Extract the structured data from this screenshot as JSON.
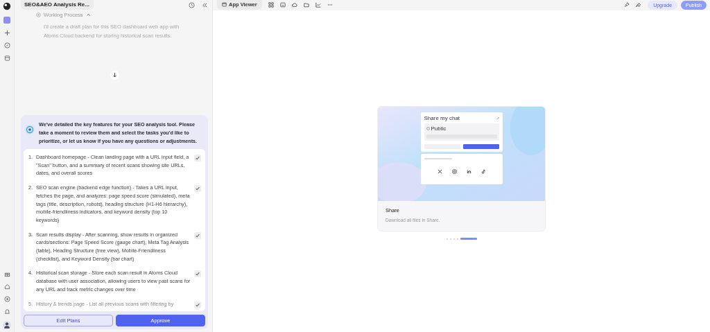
{
  "sidebar": {
    "items": [
      {
        "kind": "avatar",
        "selected": true
      },
      {
        "kind": "plus",
        "selected": false
      },
      {
        "kind": "compass",
        "selected": false
      },
      {
        "kind": "box",
        "selected": false
      }
    ],
    "bottom_items": [
      {
        "kind": "gift"
      },
      {
        "kind": "home"
      },
      {
        "kind": "target"
      },
      {
        "kind": "bell"
      },
      {
        "kind": "user"
      }
    ]
  },
  "chat": {
    "title": "SEO&AEO Analysis Re...",
    "working_process": {
      "label": "Working Process",
      "expanded": true,
      "text": "I'll create a draft plan for this SEO dashboard web app with Atoms Cloud backend for storing historical scan results."
    },
    "prompt": "We've detailed the key features for your SEO analysis tool. Please take a moment to review them and select the tasks you'd like to prioritize, or let us know if you have any questions or adjustments.",
    "tasks": [
      {
        "number": "1.",
        "text": "Dashboard homepage - Clean landing page with a URL input field, a \"Scan\" button, and a summary of recent scans showing site URLs, dates, and overall scores",
        "checked": true,
        "faded": false
      },
      {
        "number": "2.",
        "text": "SEO scan engine (backend edge function) - Takes a URL input, fetches the page, and analyzes: page speed score (simulated), meta tags (title, description, robots), heading structure (H1-H6 hierarchy), mobile-friendliness indicators, and keyword density (top 10 keywords)",
        "checked": true,
        "faded": false
      },
      {
        "number": "3.",
        "text": "Scan results display - After scanning, show results in organized cards/sections: Page Speed Score (gauge chart), Meta Tag Analysis (table), Heading Structure (tree view), Mobile-Friendliness (checklist), and Keyword Density (bar chart)",
        "checked": true,
        "faded": false
      },
      {
        "number": "4.",
        "text": "Historical scan storage - Store each scan result in Atoms Cloud database with user association, allowing users to view past scans for any URL and track metric changes over time",
        "checked": true,
        "faded": false
      },
      {
        "number": "5.",
        "text": "History & trends page - List all previous scans with filtering by",
        "checked": true,
        "faded": true
      }
    ],
    "buttons": [
      {
        "label": "Edit Plans",
        "kind": "secondary"
      },
      {
        "label": "Approve",
        "kind": "primary"
      }
    ]
  },
  "viewer": {
    "tab": "App Viewer",
    "tools": [
      {
        "kind": "grid"
      },
      {
        "kind": "preview"
      },
      {
        "kind": "cloud"
      },
      {
        "kind": "folder"
      },
      {
        "kind": "chart"
      },
      {
        "kind": "more"
      }
    ],
    "upgrade": "Upgrade",
    "publish": {
      "label": "Publish",
      "disabled": true
    },
    "card": {
      "preview_title": "Share my chat",
      "preview_option": "Public",
      "title": "Share",
      "description": "Download all files in Share."
    },
    "dots": [
      {
        "selected": false
      },
      {
        "selected": false
      },
      {
        "selected": false
      },
      {
        "selected": false
      },
      {
        "selected": true
      }
    ]
  }
}
